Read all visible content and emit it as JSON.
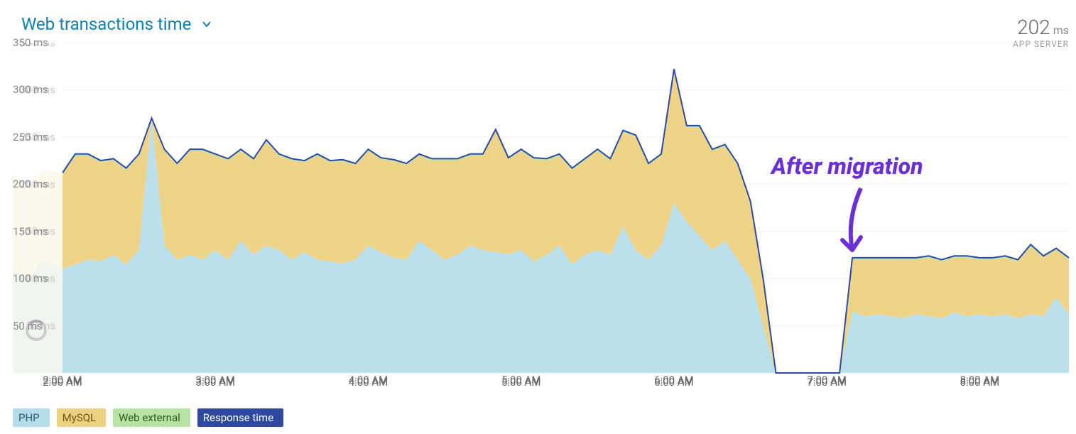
{
  "header": {
    "title": "Web transactions time",
    "metric_value": "202",
    "metric_unit": "ms",
    "metric_sub": "APP SERVER"
  },
  "annotation": {
    "label": "After migration"
  },
  "legend": [
    {
      "label": "PHP",
      "color": "#b4ddea",
      "text": "#2a5868"
    },
    {
      "label": "MySQL",
      "color": "#edd182",
      "text": "#6b5510"
    },
    {
      "label": "Web external",
      "color": "#b8e2a4",
      "text": "#2f5a1e"
    },
    {
      "label": "Response time",
      "color": "#2d4aa0",
      "text": "#ffffff"
    }
  ],
  "chart_data": {
    "type": "area",
    "title": "Web transactions time",
    "xlabel": "",
    "ylabel": "ms",
    "ylim": [
      0,
      350
    ],
    "x_categories": [
      "2:00 AM",
      "3:00 AM",
      "4:00 AM",
      "5:00 AM",
      "6:00 AM",
      "7:00 AM",
      "8:00 AM"
    ],
    "y_ticks": [
      50,
      100,
      150,
      200,
      250,
      300,
      350
    ],
    "x": [
      0,
      1,
      2,
      3,
      4,
      5,
      6,
      7,
      8,
      9,
      10,
      11,
      12,
      13,
      14,
      15,
      16,
      17,
      18,
      19,
      20,
      21,
      22,
      23,
      24,
      25,
      26,
      27,
      28,
      29,
      30,
      31,
      32,
      33,
      34,
      35,
      36,
      37,
      38,
      39,
      40,
      41,
      42,
      43,
      44,
      45,
      46,
      47,
      48,
      49,
      50,
      51,
      52,
      53,
      54,
      55,
      56,
      57,
      58,
      59,
      60,
      61,
      62,
      63,
      64,
      65,
      66,
      67,
      68,
      69,
      70,
      71,
      72,
      73,
      74,
      75,
      76,
      77,
      78,
      79
    ],
    "series": [
      {
        "name": "PHP",
        "color": "#b4ddea",
        "values": [
          110,
          115,
          120,
          118,
          125,
          115,
          130,
          270,
          135,
          120,
          125,
          120,
          130,
          120,
          140,
          125,
          135,
          130,
          120,
          128,
          120,
          118,
          116,
          120,
          135,
          128,
          122,
          120,
          140,
          130,
          120,
          125,
          135,
          130,
          128,
          126,
          130,
          118,
          125,
          135,
          115,
          125,
          130,
          125,
          155,
          130,
          120,
          135,
          180,
          160,
          145,
          130,
          140,
          120,
          100,
          50,
          0,
          0,
          0,
          0,
          0,
          0,
          65,
          60,
          62,
          60,
          58,
          62,
          60,
          58,
          64,
          60,
          62,
          60,
          62,
          58,
          62,
          60,
          80,
          62
        ]
      },
      {
        "name": "MySQL",
        "color": "#edd182",
        "values": [
          100,
          115,
          110,
          105,
          100,
          100,
          100,
          0,
          100,
          100,
          110,
          115,
          100,
          105,
          95,
          100,
          110,
          100,
          105,
          95,
          110,
          105,
          108,
          100,
          100,
          98,
          102,
          100,
          90,
          95,
          105,
          100,
          95,
          100,
          128,
          100,
          105,
          108,
          100,
          95,
          100,
          100,
          105,
          100,
          100,
          120,
          100,
          95,
          140,
          100,
          115,
          105,
          100,
          100,
          80,
          50,
          0,
          0,
          0,
          0,
          0,
          0,
          55,
          60,
          58,
          60,
          62,
          58,
          62,
          60,
          58,
          62,
          58,
          60,
          60,
          60,
          72,
          62,
          50,
          58
        ]
      },
      {
        "name": "Web external",
        "color": "#b8e2a4",
        "values": [
          2,
          2,
          2,
          2,
          2,
          2,
          2,
          0,
          2,
          2,
          2,
          2,
          2,
          2,
          2,
          2,
          2,
          2,
          2,
          2,
          2,
          2,
          2,
          2,
          2,
          2,
          2,
          2,
          2,
          2,
          2,
          2,
          2,
          2,
          2,
          2,
          2,
          2,
          2,
          2,
          2,
          2,
          2,
          2,
          2,
          2,
          2,
          2,
          2,
          2,
          2,
          2,
          2,
          2,
          2,
          0,
          0,
          0,
          0,
          0,
          0,
          0,
          2,
          2,
          2,
          2,
          2,
          2,
          2,
          2,
          2,
          2,
          2,
          2,
          2,
          2,
          2,
          2,
          2,
          2
        ]
      }
    ],
    "response_time": {
      "name": "Response time",
      "color": "#2d4aa0",
      "note": "sum of stacked series"
    }
  }
}
